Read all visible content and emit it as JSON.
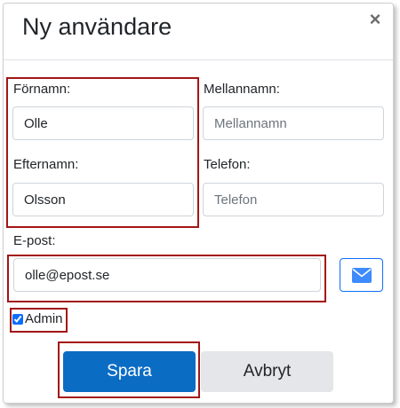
{
  "modal": {
    "title": "Ny användare",
    "close_label": "×"
  },
  "form": {
    "firstname": {
      "label": "Förnamn:",
      "value": "Olle",
      "placeholder": ""
    },
    "middlename": {
      "label": "Mellannamn:",
      "value": "",
      "placeholder": "Mellannamn"
    },
    "lastname": {
      "label": "Efternamn:",
      "value": "Olsson",
      "placeholder": ""
    },
    "phone": {
      "label": "Telefon:",
      "value": "",
      "placeholder": "Telefon"
    },
    "email": {
      "label": "E-post:",
      "value": "olle@epost.se",
      "placeholder": ""
    },
    "admin": {
      "label": "Admin",
      "checked": true
    }
  },
  "buttons": {
    "save_label": "Spara",
    "cancel_label": "Avbryt",
    "mail_icon": "envelope-icon"
  },
  "colors": {
    "primary": "#0b6cc4",
    "secondary": "#e4e6e9",
    "highlight": "#a31515"
  }
}
